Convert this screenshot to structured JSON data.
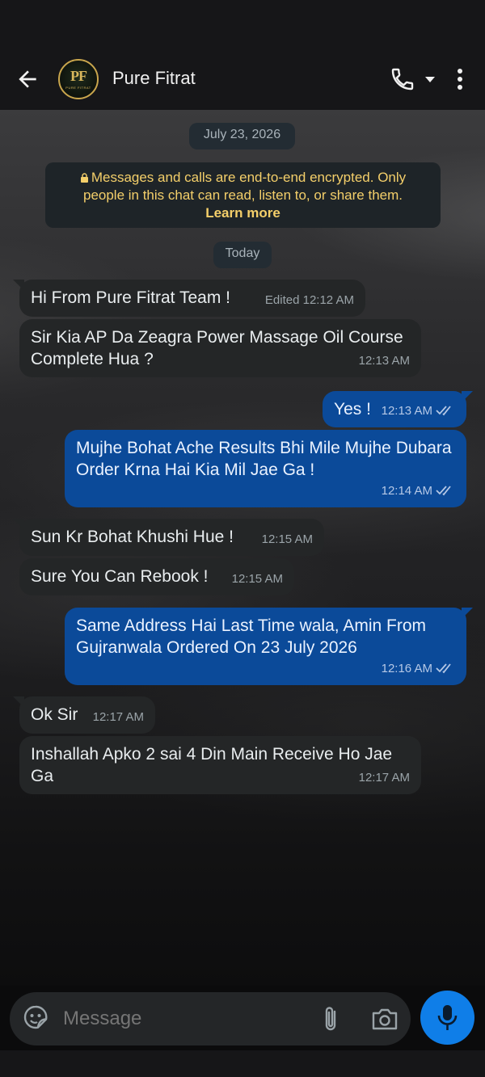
{
  "header": {
    "contact_name": "Pure Fitrat",
    "avatar_monogram": "PF",
    "avatar_caption": "PURE FITRAT"
  },
  "date_chip": "July 23, 2026",
  "encryption_notice": {
    "text": "Messages and calls are end-to-end encrypted. Only people in this chat can read, listen to, or share them.",
    "link": "Learn more"
  },
  "today_chip": "Today",
  "messages": [
    {
      "dir": "in",
      "text": "Hi From Pure Fitrat Team !",
      "edited": "Edited",
      "time": "12:12 AM"
    },
    {
      "dir": "in",
      "text": "Sir Kia AP Da Zeagra Power Massage Oil Course Complete Hua ?",
      "time": "12:13 AM"
    },
    {
      "dir": "out",
      "text": "Yes !",
      "time": "12:13 AM"
    },
    {
      "dir": "out",
      "text": "Mujhe Bohat Ache Results Bhi Mile Mujhe Dubara Order Krna Hai Kia Mil Jae Ga !",
      "time": "12:14 AM"
    },
    {
      "dir": "in",
      "text": "Sun Kr Bohat Khushi Hue !",
      "time": "12:15 AM"
    },
    {
      "dir": "in",
      "text": "Sure You Can Rebook !",
      "time": "12:15 AM"
    },
    {
      "dir": "out",
      "text": "Same Address Hai Last Time wala, Amin From Gujranwala Ordered On 23 July 2026",
      "time": "12:16 AM"
    },
    {
      "dir": "in",
      "text": "Ok Sir",
      "time": "12:17 AM"
    },
    {
      "dir": "in",
      "text": "Inshallah Apko 2 sai 4 Din Main Receive Ho Jae Ga",
      "time": "12:17 AM"
    }
  ],
  "composer": {
    "placeholder": "Message"
  },
  "colors": {
    "outgoing_bubble": "#0b4a99",
    "incoming_bubble": "#242627",
    "encryption_text": "#f4cf6a",
    "mic_button": "#0f7ee8"
  },
  "icons": [
    "back-arrow-icon",
    "phone-icon",
    "chevron-down-icon",
    "more-vert-icon",
    "lock-icon",
    "double-check-icon",
    "sticker-icon",
    "paperclip-icon",
    "camera-icon",
    "mic-icon"
  ]
}
